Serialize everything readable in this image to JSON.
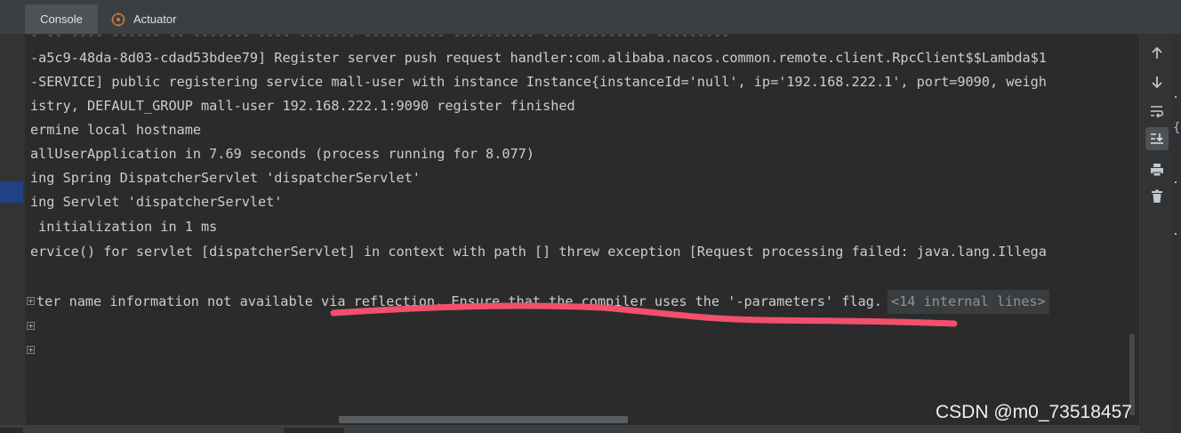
{
  "tabs": [
    {
      "label": "Console",
      "active": true
    },
    {
      "label": "Actuator",
      "icon": "actuator-icon"
    }
  ],
  "console": {
    "lines": [
      "-a5c9-48da-8d03-cdad53bdee79] Register server push request handler:com.alibaba.nacos.common.remote.client.RpcClient$$Lambda$1",
      "-SERVICE] public registering service mall-user with instance Instance{instanceId='null', ip='192.168.222.1', port=9090, weigh",
      "istry, DEFAULT_GROUP mall-user 192.168.222.1:9090 register finished",
      "ermine local hostname",
      "allUserApplication in 7.69 seconds (process running for 8.077)",
      "ing Spring DispatcherServlet 'dispatcherServlet'",
      "ing Servlet 'dispatcherServlet'",
      " initialization in 1 ms",
      "ervice() for servlet [dispatcherServlet] in context with path [] threw exception [Request processing failed: java.lang.Illega",
      "",
      "ter name information not available via reflection. Ensure that the compiler uses the '-parameters' flag."
    ],
    "internal_lines_label": "<14 internal lines>"
  },
  "toolbar": {
    "icons": [
      "up-arrow-icon",
      "down-arrow-icon",
      "soft-wrap-icon",
      "scroll-to-end-icon",
      "print-icon",
      "clear-all-icon"
    ]
  },
  "watermark": "CSDN @m0_73518457",
  "colors": {
    "background": "#2b2b2b",
    "text": "#c9cdd2",
    "annotation_underline": "#f0506e"
  }
}
